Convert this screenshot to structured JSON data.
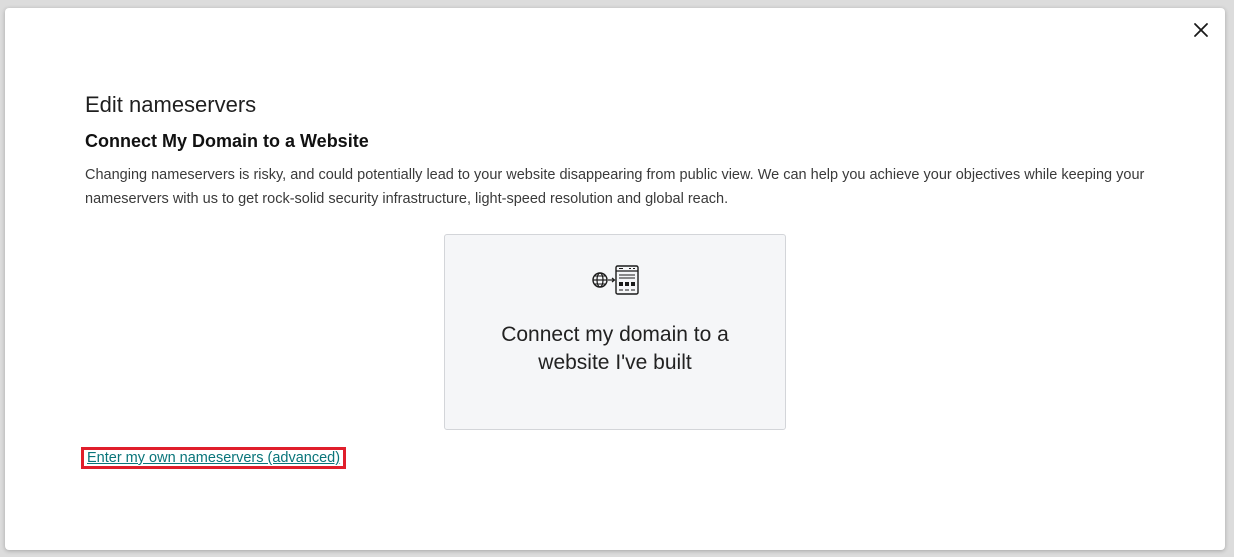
{
  "dialog": {
    "title": "Edit nameservers",
    "subtitle": "Connect My Domain to a Website",
    "description": "Changing nameservers is risky, and could potentially lead to your website disappearing from public view. We can help you achieve your objectives while keeping your nameservers with us to get rock-solid security infrastructure, light-speed resolution and global reach.",
    "close_icon": "close-icon"
  },
  "option_card": {
    "icon": "globe-to-server-icon",
    "label": "Connect my domain to a website I've built"
  },
  "advanced_link": {
    "label": "Enter my own nameservers (advanced)"
  },
  "colors": {
    "link": "#09757a",
    "highlight_border": "#e01e2b",
    "card_background": "#f5f6f8"
  }
}
